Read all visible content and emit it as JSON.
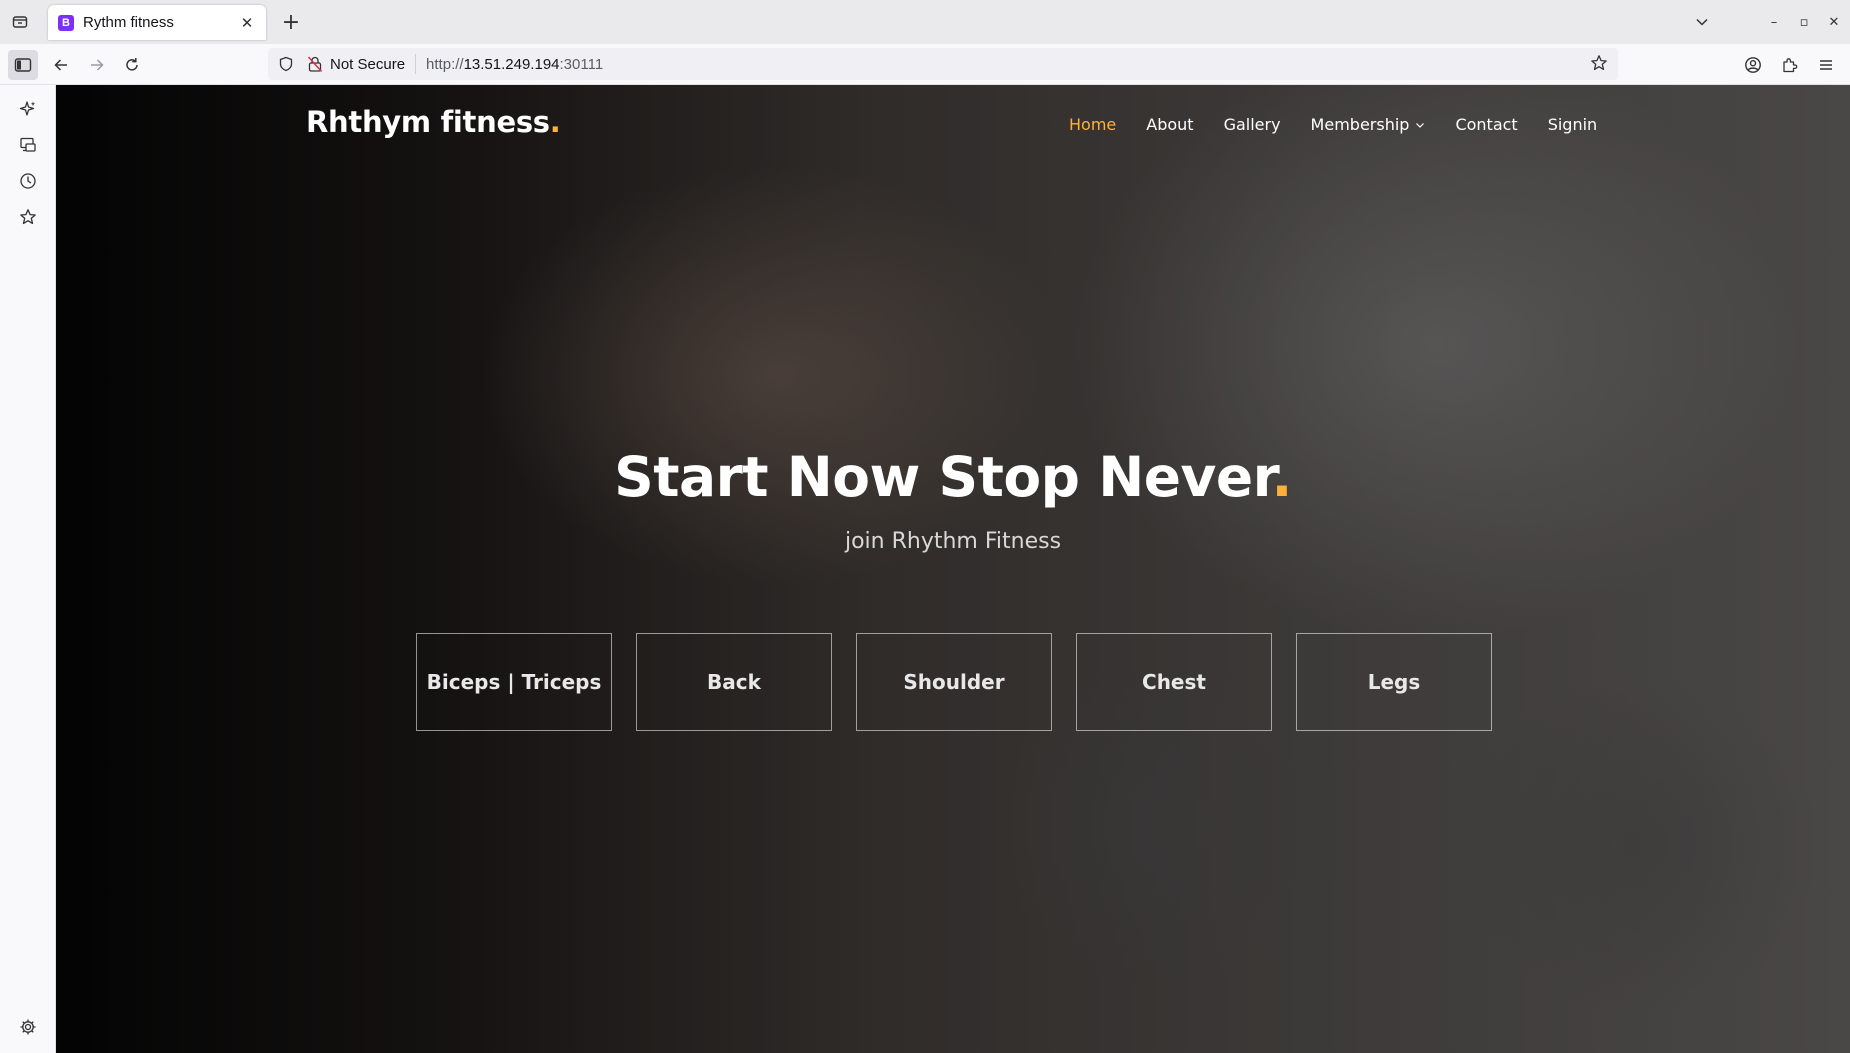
{
  "browser": {
    "tab": {
      "title": "Rythm fitness",
      "favicon_letter": "B"
    },
    "url": {
      "security_label": "Not Secure",
      "scheme": "http://",
      "host": "13.51.249.194",
      "port": ":30111"
    },
    "icons": {
      "tab_list": "tab-list-icon",
      "new_tab": "plus-icon",
      "tabs_dropdown": "chevron-down-icon",
      "sidebar_toggle": "sidebar-icon",
      "back": "arrow-left-icon",
      "forward": "arrow-right-icon",
      "reload": "reload-icon",
      "bookmark": "star-icon",
      "account": "account-icon",
      "extensions": "puzzle-icon",
      "menu": "hamburger-icon"
    },
    "window_controls": {
      "minimize": "–",
      "restore": "▫",
      "close": "✕"
    },
    "tab_close": "✕",
    "new_tab_label": "+"
  },
  "site": {
    "brand": {
      "name": "Rhthym fitness",
      "dot": "."
    },
    "nav": [
      {
        "label": "Home",
        "active": true
      },
      {
        "label": "About",
        "active": false
      },
      {
        "label": "Gallery",
        "active": false
      },
      {
        "label": "Membership",
        "active": false,
        "has_dropdown": true
      },
      {
        "label": "Contact",
        "active": false
      },
      {
        "label": "Signin",
        "active": false
      }
    ],
    "hero": {
      "title": "Start Now Stop Never",
      "title_dot": ".",
      "subtitle": "join Rhythm Fitness"
    },
    "categories": [
      "Biceps | Triceps",
      "Back",
      "Shoulder",
      "Chest",
      "Legs"
    ],
    "colors": {
      "accent": "#ffb03b",
      "text": "#ffffff"
    }
  }
}
